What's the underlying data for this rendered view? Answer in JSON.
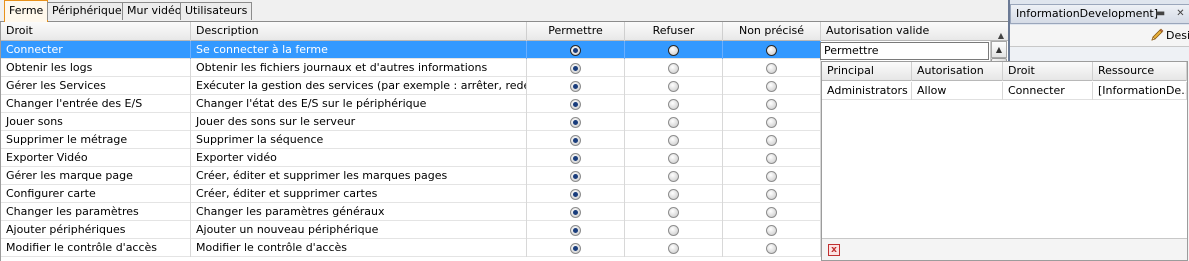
{
  "tabs": [
    {
      "label": "Ferme",
      "active": true
    },
    {
      "label": "Périphériques",
      "active": false
    },
    {
      "label": "Mur vidéo",
      "active": false
    },
    {
      "label": "Utilisateurs",
      "active": false
    }
  ],
  "grid": {
    "columns": [
      "Droit",
      "Description",
      "Permettre",
      "Refuser",
      "Non précisé",
      "Autorisation valide"
    ],
    "rows": [
      {
        "droit": "Connecter",
        "description": "Se connecter à la ferme",
        "choice": "Permettre",
        "selected": true
      },
      {
        "droit": "Obtenir les logs",
        "description": "Obtenir les fichiers journaux et d'autres informations",
        "choice": "Permettre",
        "selected": false
      },
      {
        "droit": "Gérer les Services",
        "description": "Exécuter la gestion des services (par exemple : arrêter, redémarr...",
        "choice": "Permettre",
        "selected": false
      },
      {
        "droit": "Changer l'entrée des E/S",
        "description": "Changer l'état des E/S sur le périphérique",
        "choice": "Permettre",
        "selected": false
      },
      {
        "droit": "Jouer sons",
        "description": "Jouer des sons sur le serveur",
        "choice": "Permettre",
        "selected": false
      },
      {
        "droit": "Supprimer le métrage",
        "description": "Supprimer la séquence",
        "choice": "Permettre",
        "selected": false
      },
      {
        "droit": "Exporter Vidéo",
        "description": "Exporter vidéo",
        "choice": "Permettre",
        "selected": false
      },
      {
        "droit": "Gérer les marque page",
        "description": "Créer, éditer et supprimer les marques pages",
        "choice": "Permettre",
        "selected": false
      },
      {
        "droit": "Configurer carte",
        "description": "Créer, éditer et supprimer cartes",
        "choice": "Permettre",
        "selected": false
      },
      {
        "droit": "Changer les paramètres",
        "description": "Changer les paramètres généraux",
        "choice": "Permettre",
        "selected": false
      },
      {
        "droit": "Ajouter périphériques",
        "description": "Ajouter un nouveau périphérique",
        "choice": "Permettre",
        "selected": false
      },
      {
        "droit": "Modifier le contrôle d'accès",
        "description": "Modifier le contrôle d'accès",
        "choice": "Permettre",
        "selected": false
      }
    ],
    "autorisation_value": "Permettre"
  },
  "subpanel": {
    "columns": [
      "Principal",
      "Autorisation",
      "Droit",
      "Ressource"
    ],
    "rows": [
      {
        "principal": "Administrators",
        "autorisation": "Allow",
        "droit": "Connecter",
        "ressource": "[InformationDe..."
      }
    ]
  },
  "rightpanel": {
    "title": "InformationDevelopment]",
    "design_label": "Desi"
  },
  "colors": {
    "selection": "#3399ff",
    "active_tab_border": "#e8911a"
  }
}
